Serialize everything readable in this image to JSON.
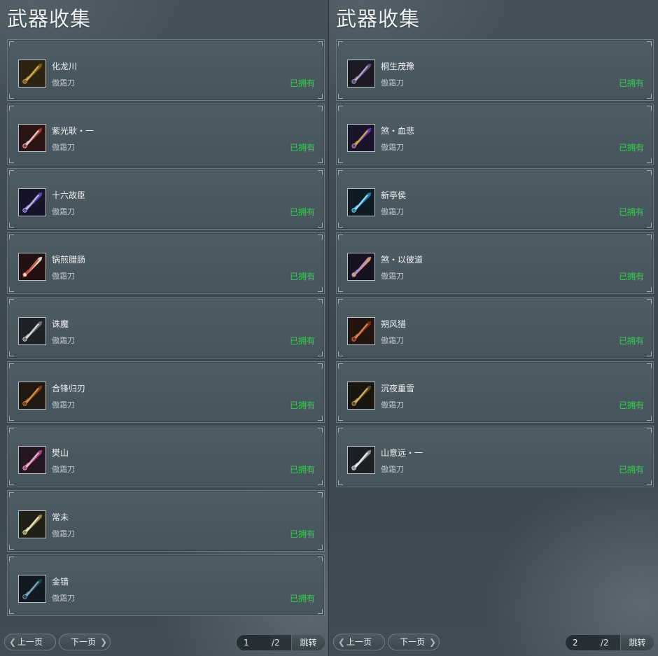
{
  "left": {
    "title": "武器收集",
    "items": [
      {
        "name": "化龙川",
        "type": "傲霜刀",
        "status": "已拥有",
        "icon": "gold-blade-icon"
      },
      {
        "name": "紫光耿・一",
        "type": "傲霜刀",
        "status": "已拥有",
        "icon": "crimson-white-blade-icon"
      },
      {
        "name": "十六故臣",
        "type": "傲霜刀",
        "status": "已拥有",
        "icon": "violet-blade-icon"
      },
      {
        "name": "锅煎腊肠",
        "type": "傲霜刀",
        "status": "已拥有",
        "icon": "sausage-blade-icon"
      },
      {
        "name": "诛魔",
        "type": "傲霜刀",
        "status": "已拥有",
        "icon": "silver-blade-icon"
      },
      {
        "name": "合锋归刃",
        "type": "傲霜刀",
        "status": "已拥有",
        "icon": "bronze-blade-icon"
      },
      {
        "name": "樊山",
        "type": "傲霜刀",
        "status": "已拥有",
        "icon": "pink-blade-icon"
      },
      {
        "name": "常未",
        "type": "傲霜刀",
        "status": "已拥有",
        "icon": "ivory-blade-icon"
      },
      {
        "name": "金错",
        "type": "傲霜刀",
        "status": "已拥有",
        "icon": "dark-teal-blade-icon"
      }
    ],
    "pager": {
      "prev_label": "上一页",
      "next_label": "下一页",
      "page": "1",
      "total": "/2",
      "jump_label": "跳转"
    }
  },
  "right": {
    "title": "武器收集",
    "items": [
      {
        "name": "桐生茂豫",
        "type": "傲霜刀",
        "status": "已拥有",
        "icon": "purple-grey-blade-icon"
      },
      {
        "name": "煞・血悲",
        "type": "傲霜刀",
        "status": "已拥有",
        "icon": "purple-gold-blade-icon"
      },
      {
        "name": "新亭侯",
        "type": "傲霜刀",
        "status": "已拥有",
        "icon": "ice-blade-icon"
      },
      {
        "name": "煞・以彼道",
        "type": "傲霜刀",
        "status": "已拥有",
        "icon": "dusk-blade-icon"
      },
      {
        "name": "朔风猎",
        "type": "傲霜刀",
        "status": "已拥有",
        "icon": "rust-blade-icon"
      },
      {
        "name": "沉夜重雪",
        "type": "傲霜刀",
        "status": "已拥有",
        "icon": "spiral-blade-icon"
      },
      {
        "name": "山意远・一",
        "type": "傲霜刀",
        "status": "已拥有",
        "icon": "white-blade-icon"
      }
    ],
    "pager": {
      "prev_label": "上一页",
      "next_label": "下一页",
      "page": "2",
      "total": "/2",
      "jump_label": "跳转"
    }
  },
  "colors": {
    "owned": "#36d24e",
    "card_bg": "#4a5860",
    "border": "#6c7d86"
  }
}
